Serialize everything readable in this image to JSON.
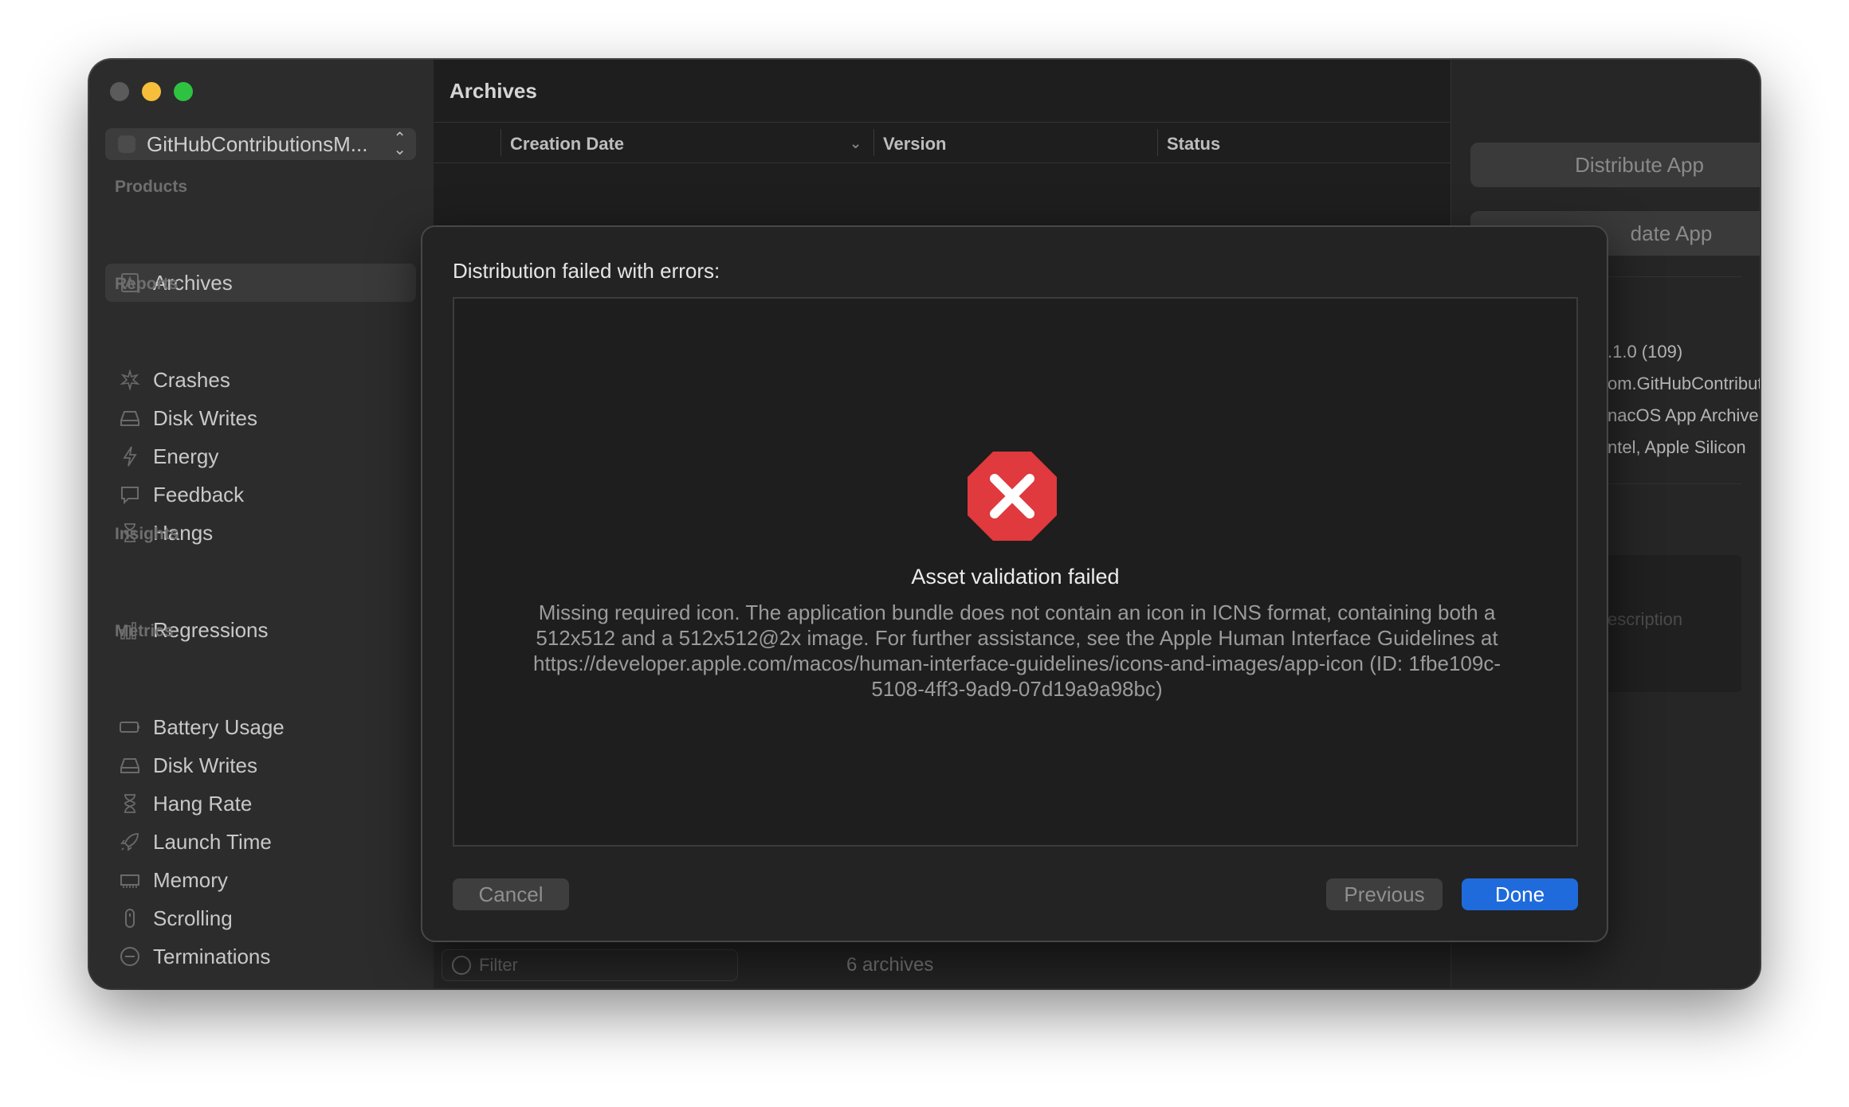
{
  "sidebar": {
    "scheme_label": "GitHubContributionsM...",
    "sections": [
      {
        "label": "Products"
      },
      {
        "label": "Reports"
      },
      {
        "label": "Insights"
      },
      {
        "label": "Metrics"
      }
    ],
    "items": [
      {
        "label": "Archives",
        "icon": "archive-icon"
      },
      {
        "label": "Crashes",
        "icon": "crash-icon"
      },
      {
        "label": "Disk Writes",
        "icon": "disk-icon"
      },
      {
        "label": "Energy",
        "icon": "bolt-icon"
      },
      {
        "label": "Feedback",
        "icon": "speech-bubble-icon"
      },
      {
        "label": "Hangs",
        "icon": "hourglass-icon"
      },
      {
        "label": "Regressions",
        "icon": "bar-chart-icon"
      },
      {
        "label": "Battery Usage",
        "icon": "battery-icon"
      },
      {
        "label": "Disk Writes",
        "icon": "disk-icon"
      },
      {
        "label": "Hang Rate",
        "icon": "hourglass-icon"
      },
      {
        "label": "Launch Time",
        "icon": "rocket-icon"
      },
      {
        "label": "Memory",
        "icon": "memory-chip-icon"
      },
      {
        "label": "Scrolling",
        "icon": "scroll-icon"
      },
      {
        "label": "Terminations",
        "icon": "minus-circle-icon"
      }
    ]
  },
  "center": {
    "title": "Archives",
    "columns": [
      "Creation Date",
      "Version",
      "Status"
    ],
    "filter_placeholder": "Filter",
    "archive_count": "6 archives"
  },
  "inspector": {
    "distribute_button": "Distribute App",
    "validate_button": "date App",
    "values": [
      ".1.0 (109)",
      "om.GitHubContributi...",
      "nacOS App Archive",
      "ntel, Apple Silicon"
    ],
    "description_placeholder": "escription"
  },
  "modal": {
    "title": "Distribution failed with errors:",
    "error_title": "Asset validation failed",
    "error_message": "Missing required icon. The application bundle does not contain an icon in ICNS format, containing both a 512x512 and a 512x512@2x image. For further assistance, see the Apple Human Interface Guidelines at https://developer.apple.com/macos/human-interface-guidelines/icons-and-images/app-icon (ID: 1fbe109c-5108-4ff3-9ad9-07d19a9a98bc)",
    "cancel_label": "Cancel",
    "previous_label": "Previous",
    "done_label": "Done"
  },
  "colors": {
    "accent": "#1f6bdc",
    "error": "#e0393e"
  }
}
